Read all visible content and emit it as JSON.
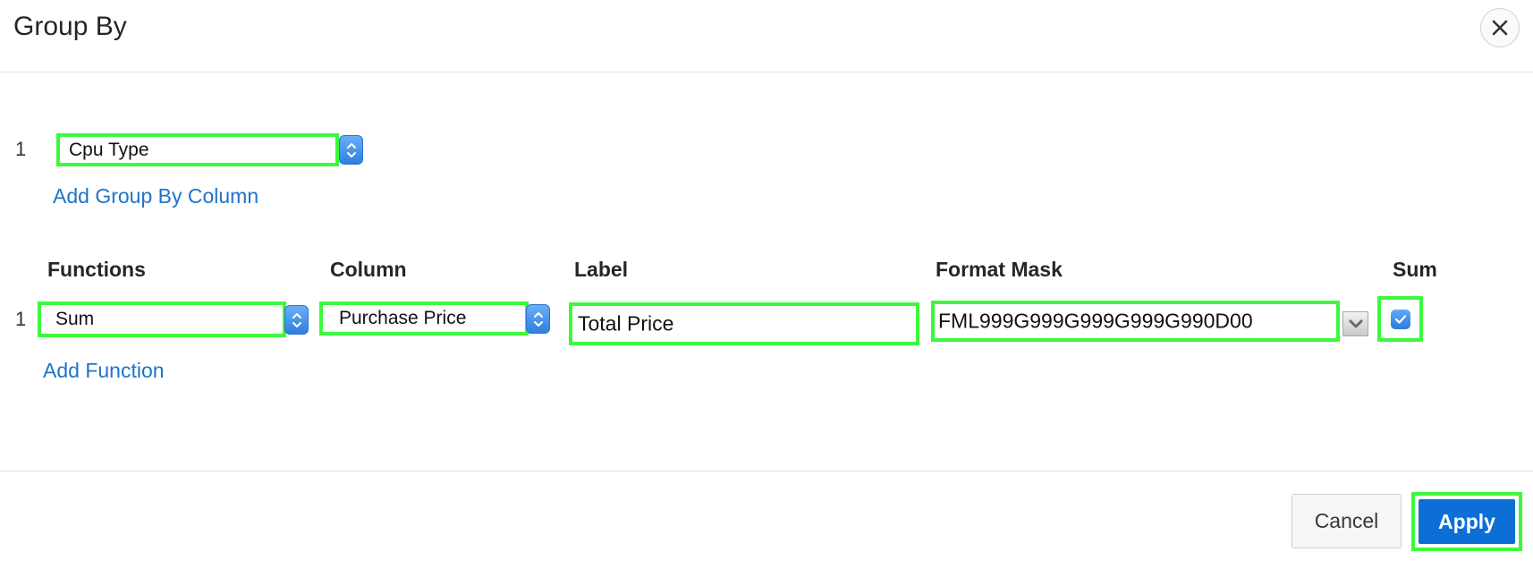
{
  "dialog": {
    "title": "Group By",
    "close_icon": "close-icon"
  },
  "group_by": {
    "row_number": "1",
    "column_value": "Cpu Type",
    "add_link": "Add Group By Column"
  },
  "functions_table": {
    "headers": {
      "functions": "Functions",
      "column": "Column",
      "label": "Label",
      "format_mask": "Format Mask",
      "sum": "Sum"
    },
    "rows": [
      {
        "number": "1",
        "function": "Sum",
        "column": "Purchase Price",
        "label": "Total Price",
        "format_mask": "FML999G999G999G999G990D00",
        "sum_checked": true
      }
    ],
    "add_link": "Add Function"
  },
  "footer": {
    "cancel_label": "Cancel",
    "apply_label": "Apply"
  },
  "colors": {
    "accent": "#0b6fd6",
    "link": "#1f73c8",
    "highlight": "#3cf83c"
  }
}
